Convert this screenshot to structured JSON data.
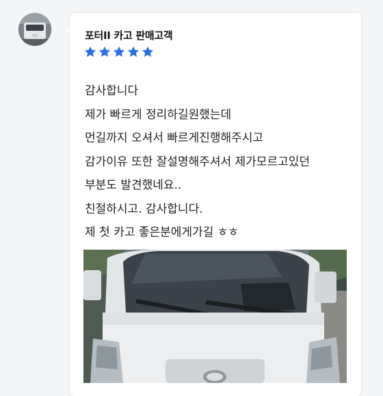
{
  "review": {
    "reviewer_name": "포터II 카고 판매고객",
    "rating": 5,
    "rating_max": 5,
    "star_color": "#2e6fde",
    "lines": [
      "감사합니다",
      "제가 빠르게 정리하길원했는데",
      "먼길까지 오셔서 빠르게진행해주시고",
      "감가이유 또한 잘설명해주셔서 제가모르고있던",
      "부분도 발견했네요..",
      "친절하시고. 감사합니다.",
      "제 첫 카고 좋은분에게가길 ㅎㅎ"
    ]
  }
}
